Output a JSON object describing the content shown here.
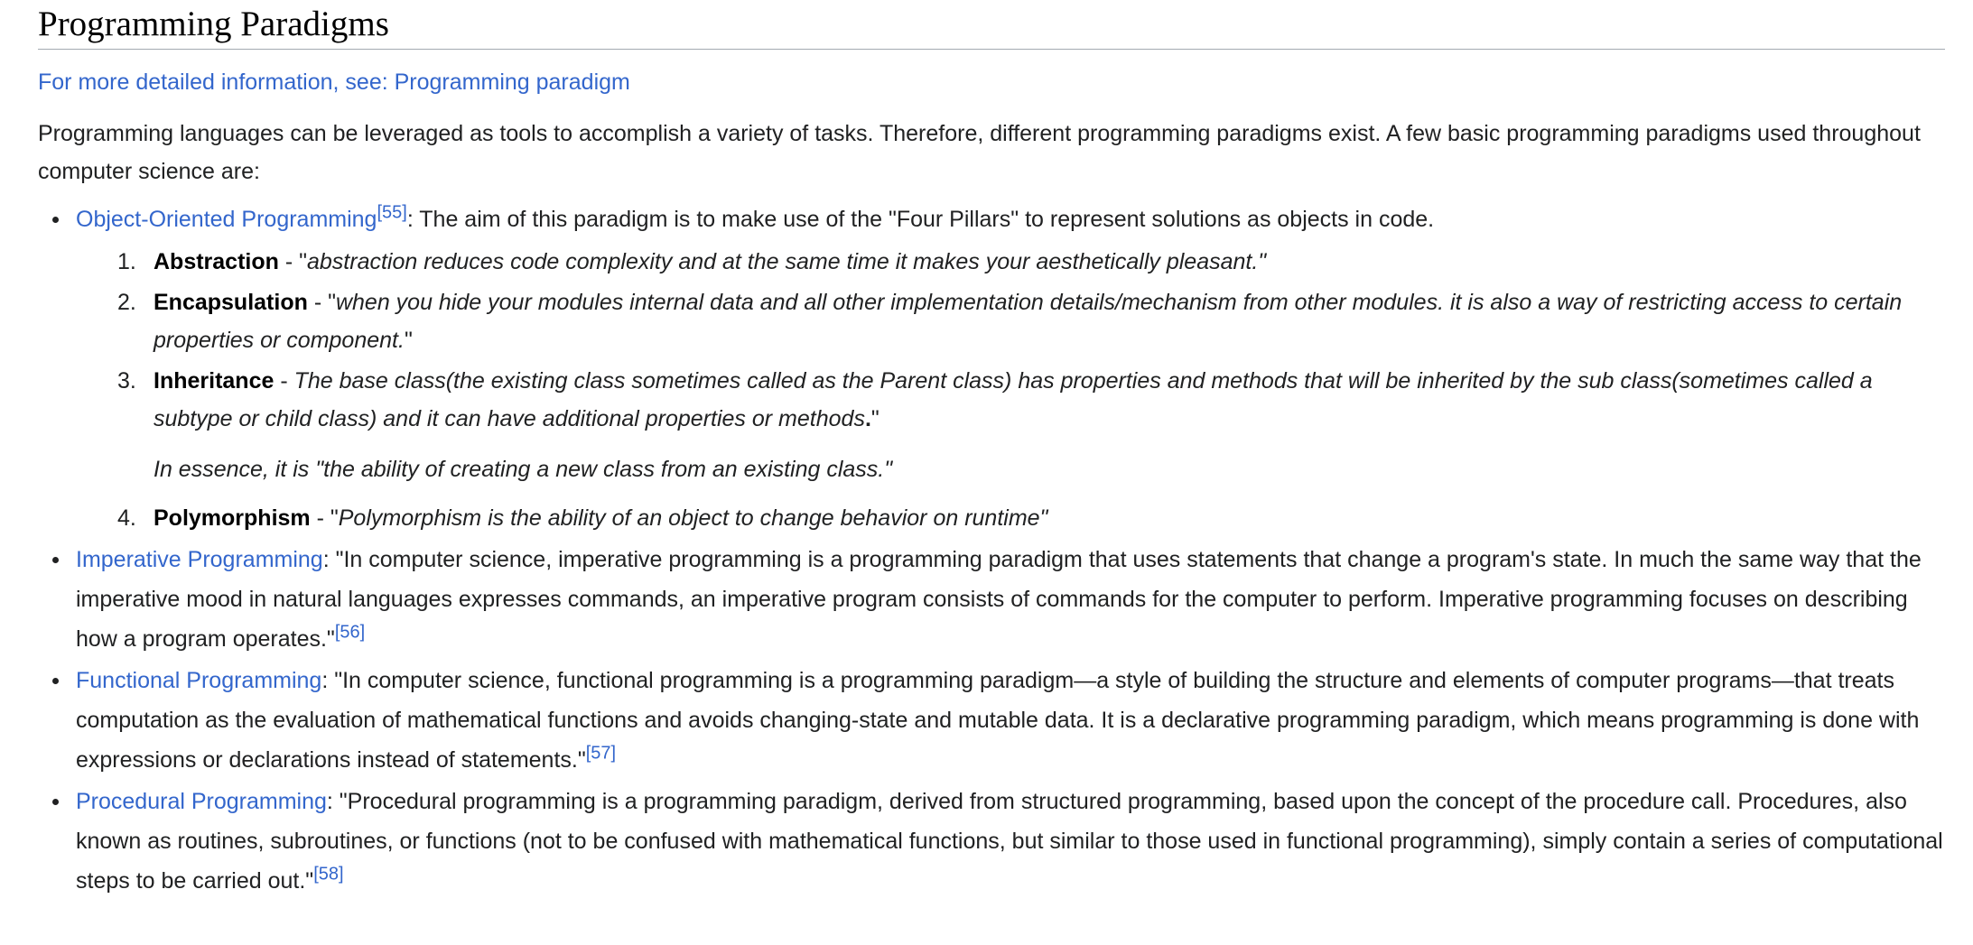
{
  "heading": "Programming Paradigms",
  "hatnote": "For more detailed information, see: Programming paradigm",
  "intro": "Programming languages can be leveraged as tools to accomplish a variety of tasks. Therefore, different programming paradigms exist. A few basic programming paradigms used throughout computer science are:",
  "colors": {
    "link": "#3366cc",
    "text": "#202122",
    "rule": "#a2a9b1"
  },
  "paradigms": [
    {
      "link": "Object-Oriented Programming",
      "ref": "[55]",
      "text": ": The aim of this paradigm is to make use of the \"Four Pillars\" to represent solutions as objects in code."
    },
    {
      "link": "Imperative Programming",
      "text": ": \"In computer science, imperative programming is a programming paradigm that uses statements that change a program's state. In much the same way that the imperative mood in natural languages expresses commands, an imperative program consists of commands for the computer to perform. Imperative programming focuses on describing how a program operates.\"",
      "ref": "[56]"
    },
    {
      "link": "Functional Programming",
      "text": ": \"In computer science, functional programming is a programming paradigm—a style of building the structure and elements of computer programs—that treats computation as the evaluation of mathematical functions and avoids changing-state and mutable data. It is a declarative programming paradigm, which means programming is done with expressions or declarations instead of statements.\"",
      "ref": "[57]"
    },
    {
      "link": "Procedural Programming",
      "text": ": \"Procedural programming is a programming paradigm, derived from structured programming, based upon the concept of the procedure call. Procedures, also known as routines, subroutines, or functions (not to be confused with mathematical functions, but similar to those used in functional programming), simply contain a series of computational steps to be carried out.\"",
      "ref": "[58]"
    }
  ],
  "pillars": [
    {
      "num": "1.",
      "term": "Abstraction",
      "sep": " - \"",
      "quote": "abstraction reduces code complexity and at the same time it makes your aesthetically pleasant.\""
    },
    {
      "num": "2.",
      "term": "Encapsulation",
      "sep": " - \"",
      "quote": "when you hide your modules internal data and all other implementation details/mechanism from other modules. it is also a way of restricting access to certain properties or component.",
      "tail": "\""
    },
    {
      "num": "3.",
      "term": "Inheritance",
      "sep": " - ",
      "quote": "The base class(the existing class sometimes called as the Parent class) has properties and methods that will be inherited by the sub class(sometimes called a subtype or child class) and it can have additional properties or methods",
      "dot": ".",
      "tail": "\"",
      "essence": "In essence, it is \"the ability of creating a new class from an existing class.\""
    },
    {
      "num": "4.",
      "term": "Polymorphism",
      "sep": " - \"",
      "quote": "Polymorphism is the ability of an object to change behavior on runtime\""
    }
  ]
}
